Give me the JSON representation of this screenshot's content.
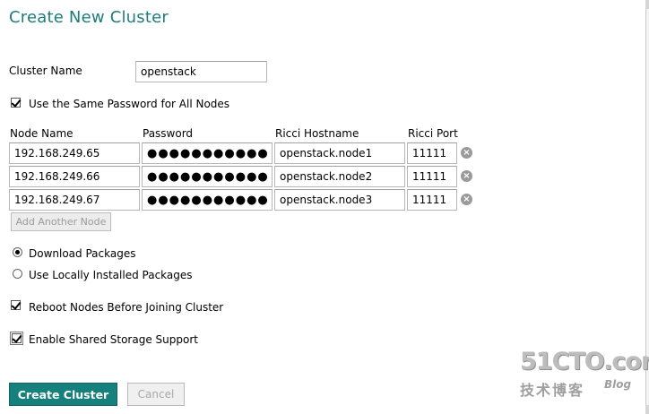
{
  "dialog": {
    "title": "Create New Cluster",
    "cluster_name_label": "Cluster Name",
    "cluster_name_value": "openstack",
    "same_password_label": "Use the Same Password for All Nodes",
    "same_password_checked": true
  },
  "nodes_table": {
    "headers": [
      "Node Name",
      "Password",
      "Ricci Hostname",
      "Ricci Port"
    ],
    "rows": [
      {
        "node_name": "192.168.249.65",
        "password": "●●●●●●●●●●●●",
        "ricci_hostname": "openstack.node1",
        "ricci_port": "11111"
      },
      {
        "node_name": "192.168.249.66",
        "password": "●●●●●●●●●●●●",
        "ricci_hostname": "openstack.node2",
        "ricci_port": "11111"
      },
      {
        "node_name": "192.168.249.67",
        "password": "●●●●●●●●●●●●",
        "ricci_hostname": "openstack.node3",
        "ricci_port": "11111"
      }
    ],
    "remove_icon": "x-circle-icon",
    "add_node_label": "Add Another Node"
  },
  "options": {
    "download_packages_label": "Download Packages",
    "use_local_packages_label": "Use Locally Installed Packages",
    "selected_package_option": "Download Packages",
    "reboot_label": "Reboot Nodes Before Joining Cluster",
    "reboot_checked": true,
    "shared_storage_label": "Enable Shared Storage Support",
    "shared_storage_checked": true
  },
  "actions": {
    "create_label": "Create Cluster",
    "cancel_label": "Cancel"
  },
  "watermark": {
    "main": "51CTO.com",
    "sub": "技术博客",
    "blog": "Blog"
  },
  "colors": {
    "title": "#1f7c7c",
    "primary_button": "#16807c"
  }
}
